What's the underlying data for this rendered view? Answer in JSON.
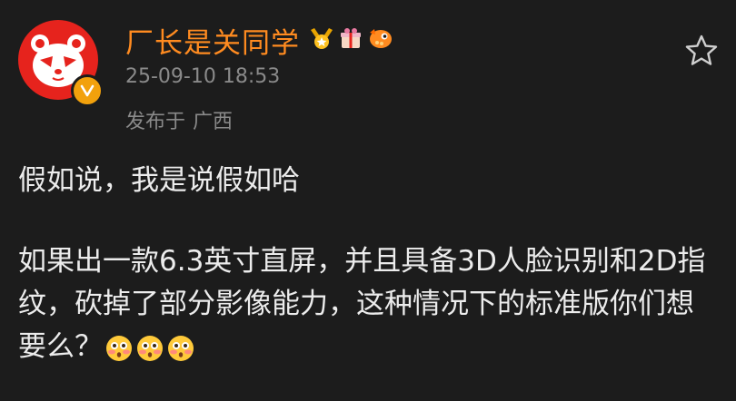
{
  "post": {
    "author": {
      "name": "厂长是关同学",
      "avatar_icon": "red-panda-avatar-icon",
      "verified_icon": "verified-v-icon",
      "badges": [
        "medal-badge-icon",
        "gift-badge-icon",
        "fish-badge-icon"
      ]
    },
    "timestamp": "25-09-10 18:53",
    "location_label": "发布于",
    "location": "广西",
    "favorite_icon": "star-outline-icon",
    "paragraph1": "假如说，我是说假如哈",
    "paragraph2": "如果出一款6.3英寸直屏，并且具备3D人脸识别和2D指纹，砍掉了部分影像能力，这种情况下的标准版你们想要么？",
    "trailing_emojis": [
      "flushed-face-emoji",
      "flushed-face-emoji",
      "flushed-face-emoji"
    ]
  },
  "colors": {
    "background": "#1c1c1c",
    "username": "#ff8b20",
    "meta_text": "#8a8a8a",
    "body_text": "#ececec",
    "avatar_bg": "#e6231d",
    "verified": "#f2a10c"
  }
}
